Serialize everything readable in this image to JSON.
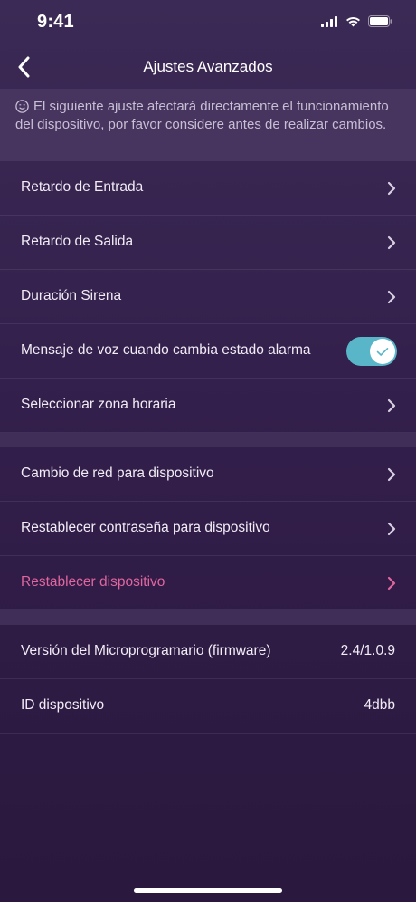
{
  "status_bar": {
    "time": "9:41"
  },
  "header": {
    "title": "Ajustes Avanzados"
  },
  "notice": {
    "icon": "smiley-icon",
    "text": "El siguiente ajuste afectará directamente el funcionamiento del dispositivo, por favor considere antes de realizar cambios."
  },
  "section1": {
    "items": [
      {
        "label": "Retardo de Entrada"
      },
      {
        "label": "Retardo de Salida"
      },
      {
        "label": "Duración Sirena"
      },
      {
        "label": "Mensaje de voz cuando cambia estado alarma",
        "toggle_on": true
      },
      {
        "label": "Seleccionar zona horaria"
      }
    ]
  },
  "section2": {
    "items": [
      {
        "label": "Cambio de red para dispositivo"
      },
      {
        "label": "Restablecer contraseña para dispositivo"
      },
      {
        "label": "Restablecer dispositivo"
      }
    ]
  },
  "section3": {
    "items": [
      {
        "label": "Versión del Microprogramario (firmware)",
        "value": "2.4/1.0.9"
      },
      {
        "label": "ID dispositivo",
        "value": "4dbb"
      }
    ]
  },
  "colors": {
    "background": "#3b2a55",
    "accent_toggle": "#59b6c8",
    "danger_text": "#e0669f"
  }
}
